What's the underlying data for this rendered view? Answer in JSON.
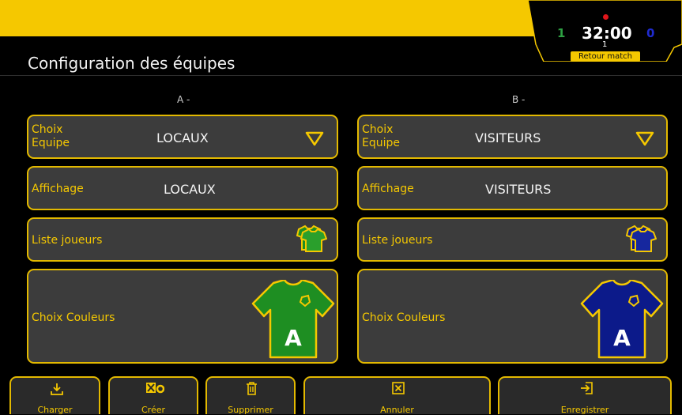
{
  "header": {
    "score_home": "1",
    "score_away": "0",
    "clock": "32:00",
    "period": "1",
    "return_label": "Retour match"
  },
  "page_title": "Configuration des équipes",
  "teams": [
    {
      "column_label": "A -",
      "choice_label": "Choix Equipe",
      "choice_value": "LOCAUX",
      "display_label": "Affichage",
      "display_value": "LOCAUX",
      "players_label": "Liste joueurs",
      "colors_label": "Choix Couleurs",
      "shirt_letter": "A",
      "shirt_color": "#1e8e22"
    },
    {
      "column_label": "B -",
      "choice_label": "Choix Equipe",
      "choice_value": "VISITEURS",
      "display_label": "Affichage",
      "display_value": "VISITEURS",
      "players_label": "Liste joueurs",
      "colors_label": "Choix Couleurs",
      "shirt_letter": "A",
      "shirt_color": "#0c1a8a"
    }
  ],
  "toolbar": {
    "load_label": "Charger",
    "create_label": "Créer",
    "delete_label": "Supprimer",
    "cancel_label": "Annuler",
    "save_label": "Enregistrer"
  },
  "colors": {
    "accent": "#f5c800",
    "panel_bg": "#3c3c3c",
    "border": "#e3b900"
  },
  "icons": [
    "download-icon",
    "create-team-icon",
    "trash-icon",
    "close-box-icon",
    "login-arrow-icon",
    "dropdown-triangle-icon",
    "team-shirts-icon",
    "jersey-icon"
  ]
}
